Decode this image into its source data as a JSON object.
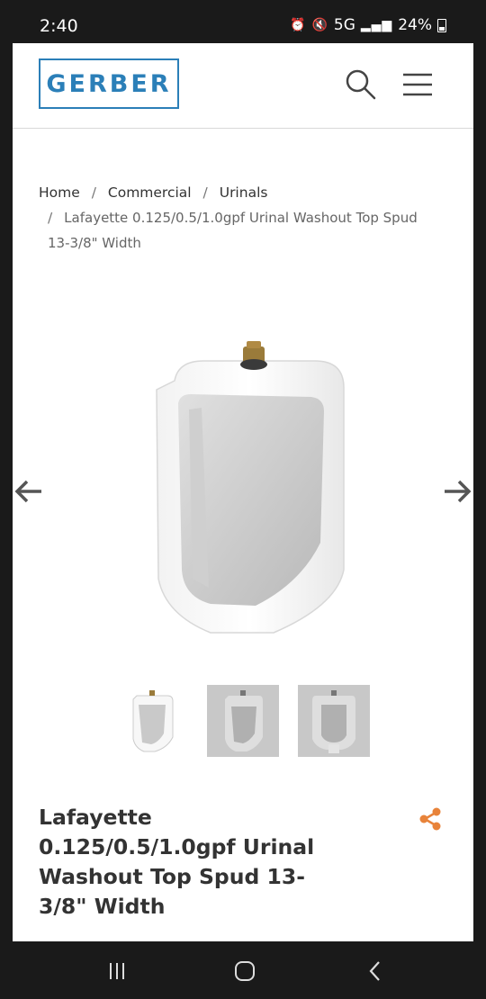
{
  "status": {
    "time": "2:40",
    "network": "5G",
    "battery": "24%",
    "icons": [
      "alarm-icon",
      "mute-icon",
      "signal-icon",
      "battery-icon"
    ]
  },
  "header": {
    "logo": "GERBER",
    "icons": [
      "search-icon",
      "menu-icon"
    ]
  },
  "breadcrumb": {
    "items": [
      "Home",
      "Commercial",
      "Urinals"
    ],
    "current_line1": "Lafayette 0.125/0.5/1.0gpf Urinal Washout Top Spud",
    "current_line2": "13-3/8\" Width",
    "separator": "/"
  },
  "gallery": {
    "thumbnail_count": 3,
    "selected_thumbnail": 1
  },
  "product": {
    "title_lines": [
      "Lafayette",
      "0.125/0.5/1.0gpf Urinal",
      "Washout Top Spud 13-",
      "3/8\" Width"
    ]
  },
  "colors": {
    "brand": "#2b7fb8",
    "accent": "#e8833a",
    "text": "#333333"
  }
}
